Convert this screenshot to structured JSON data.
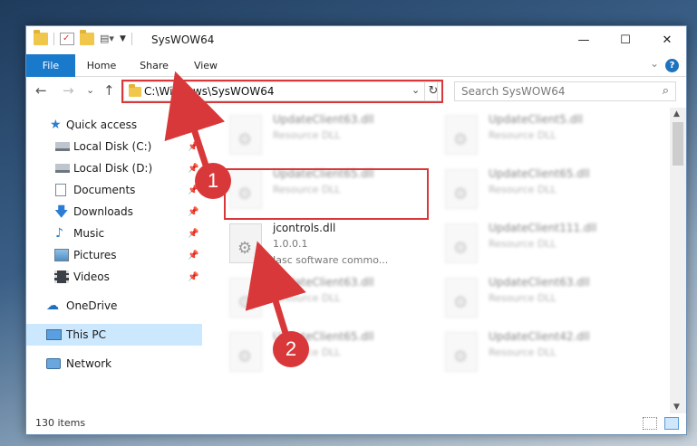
{
  "window": {
    "title": "SysWOW64",
    "minimize": "—",
    "maximize": "☐",
    "close": "✕"
  },
  "ribbon": {
    "tabs": [
      "File",
      "Home",
      "Share",
      "View"
    ],
    "help": "?",
    "collapse": "⌄"
  },
  "nav": {
    "back": "←",
    "forward": "→",
    "recent": "⌄",
    "up": "↑",
    "address": "C:\\Windows\\SysWOW64",
    "address_dropdown": "⌄",
    "refresh": "↻",
    "search_placeholder": "Search SysWOW64",
    "search_icon": "⌕"
  },
  "sidebar": {
    "items": [
      {
        "label": "Quick access",
        "icon": "star-icon",
        "pinned": false
      },
      {
        "label": "Local Disk (C:)",
        "icon": "drive-icon",
        "pinned": true
      },
      {
        "label": "Local Disk (D:)",
        "icon": "drive-icon",
        "pinned": true
      },
      {
        "label": "Documents",
        "icon": "documents-icon",
        "pinned": true
      },
      {
        "label": "Downloads",
        "icon": "download-icon",
        "pinned": true
      },
      {
        "label": "Music",
        "icon": "music-icon",
        "pinned": true
      },
      {
        "label": "Pictures",
        "icon": "pictures-icon",
        "pinned": true
      },
      {
        "label": "Videos",
        "icon": "videos-icon",
        "pinned": true
      },
      {
        "label": "OneDrive",
        "icon": "cloud-icon",
        "pinned": false
      },
      {
        "label": "This PC",
        "icon": "computer-icon",
        "pinned": false
      },
      {
        "label": "Network",
        "icon": "network-icon",
        "pinned": false
      }
    ],
    "pin_glyph": "📌"
  },
  "files": {
    "focus": {
      "name": "jcontrols.dll",
      "version": "1.0.0.1",
      "description": "Jasc software commo..."
    },
    "background": [
      {
        "name": "UpdateClient63.dll",
        "type": "Resource DLL"
      },
      {
        "name": "UpdateClient5.dll",
        "type": "Resource DLL"
      },
      {
        "name": "UpdateClient65.dll",
        "type": "Resource DLL"
      },
      {
        "name": "UpdateClient65.dll",
        "type": "Resource DLL"
      },
      {
        "name": "UpdateClient111.dll",
        "type": "Resource DLL"
      },
      {
        "name": "UpdateClient63.dll",
        "type": "Resource DLL"
      },
      {
        "name": "UpdateClient63.dll",
        "type": "Resource DLL"
      },
      {
        "name": "UpdateClient65.dll",
        "type": "Resource DLL"
      },
      {
        "name": "UpdateClient42.dll",
        "type": "Resource DLL"
      }
    ]
  },
  "status": {
    "item_count": "130 items"
  },
  "annotations": {
    "step1": "1",
    "step2": "2",
    "color": "#d9383a"
  }
}
